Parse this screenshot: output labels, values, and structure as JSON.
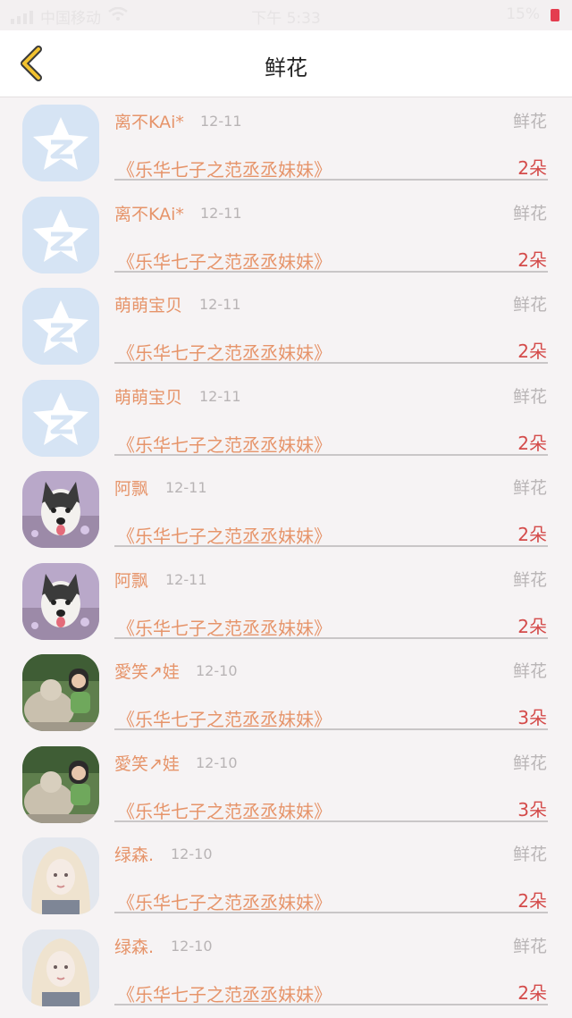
{
  "status_bar": {
    "carrier": "中国移动",
    "time": "下午 5:33",
    "battery": "15%"
  },
  "header": {
    "title": "鲜花"
  },
  "colors": {
    "accent_name": "#e6946a",
    "count_red": "#d44b4a",
    "muted": "#b9b5b6"
  },
  "items": [
    {
      "avatar": "qzone-default-avatar",
      "name": "离不KAi*",
      "date": "12-11",
      "kind": "鲜花",
      "book": "《乐华七子之范丞丞妹妹》",
      "count": "2朵"
    },
    {
      "avatar": "qzone-default-avatar",
      "name": "离不KAi*",
      "date": "12-11",
      "kind": "鲜花",
      "book": "《乐华七子之范丞丞妹妹》",
      "count": "2朵"
    },
    {
      "avatar": "qzone-default-avatar",
      "name": "萌萌宝贝",
      "date": "12-11",
      "kind": "鲜花",
      "book": "《乐华七子之范丞丞妹妹》",
      "count": "2朵"
    },
    {
      "avatar": "qzone-default-avatar",
      "name": "萌萌宝贝",
      "date": "12-11",
      "kind": "鲜花",
      "book": "《乐华七子之范丞丞妹妹》",
      "count": "2朵"
    },
    {
      "avatar": "husky-avatar",
      "name": "阿飘",
      "date": "12-11",
      "kind": "鲜花",
      "book": "《乐华七子之范丞丞妹妹》",
      "count": "2朵"
    },
    {
      "avatar": "husky-avatar",
      "name": "阿飘",
      "date": "12-11",
      "kind": "鲜花",
      "book": "《乐华七子之范丞丞妹妹》",
      "count": "2朵"
    },
    {
      "avatar": "statue-girl-avatar",
      "name": "愛笑↗娃",
      "date": "12-10",
      "kind": "鲜花",
      "book": "《乐华七子之范丞丞妹妹》",
      "count": "3朵"
    },
    {
      "avatar": "statue-girl-avatar",
      "name": "愛笑↗娃",
      "date": "12-10",
      "kind": "鲜花",
      "book": "《乐华七子之范丞丞妹妹》",
      "count": "3朵"
    },
    {
      "avatar": "blonde-girl-avatar",
      "name": "绿森.",
      "date": "12-10",
      "kind": "鲜花",
      "book": "《乐华七子之范丞丞妹妹》",
      "count": "2朵"
    },
    {
      "avatar": "blonde-girl-avatar",
      "name": "绿森.",
      "date": "12-10",
      "kind": "鲜花",
      "book": "《乐华七子之范丞丞妹妹》",
      "count": "2朵"
    }
  ]
}
